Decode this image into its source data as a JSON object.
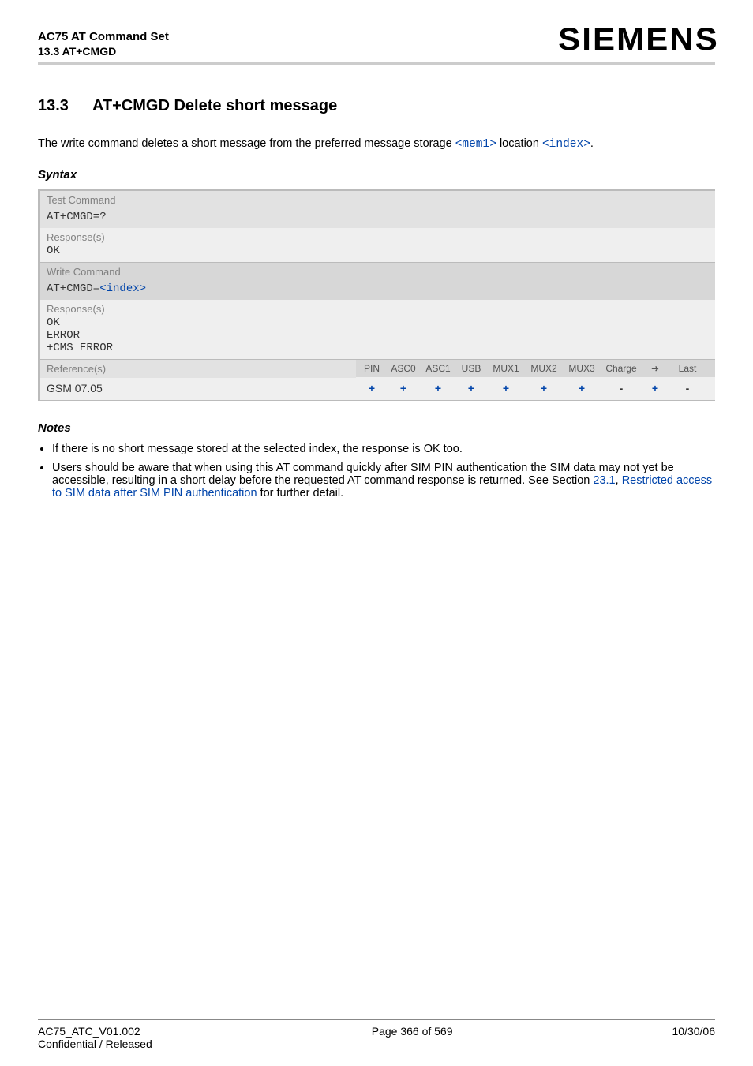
{
  "header": {
    "doc_title": "AC75 AT Command Set",
    "doc_subtitle": "13.3 AT+CMGD",
    "brand": "SIEMENS"
  },
  "section": {
    "number": "13.3",
    "title": "AT+CMGD   Delete short message"
  },
  "intro": {
    "prefix": "The write command deletes a short message from the preferred message storage ",
    "mem1": "<mem1>",
    "middle": " location ",
    "index": "<index>",
    "suffix": "."
  },
  "syntax_label": "Syntax",
  "test": {
    "label": "Test Command",
    "cmd": "AT+CMGD=?",
    "resp_label": "Response(s)",
    "resp": "OK"
  },
  "write": {
    "label": "Write Command",
    "cmd_prefix": "AT+CMGD=",
    "cmd_index": "<index>",
    "resp_label": "Response(s)",
    "resp_lines": [
      "OK",
      "ERROR",
      "+CMS ERROR"
    ]
  },
  "ref": {
    "label": "Reference(s)",
    "value": "GSM 07.05",
    "cap_headers": [
      "PIN",
      "ASC0",
      "ASC1",
      "USB",
      "MUX1",
      "MUX2",
      "MUX3",
      "Charge",
      "➜",
      "Last"
    ],
    "cap_values": [
      "+",
      "+",
      "+",
      "+",
      "+",
      "+",
      "+",
      "-",
      "+",
      "-"
    ]
  },
  "notes_label": "Notes",
  "notes": {
    "n1": "If there is no short message stored at the selected index, the response is OK too.",
    "n2_a": "Users should be aware that when using this AT command quickly after SIM PIN authentication the SIM data may not yet be accessible, resulting in a short delay before the requested AT command response is returned. See Section ",
    "n2_link1": "23.1",
    "n2_mid": ", ",
    "n2_link2": "Restricted access to SIM data after SIM PIN authentication",
    "n2_b": " for further detail."
  },
  "footer": {
    "left_line1": "AC75_ATC_V01.002",
    "left_line2": "Confidential / Released",
    "center": "Page 366 of 569",
    "right": "10/30/06"
  }
}
